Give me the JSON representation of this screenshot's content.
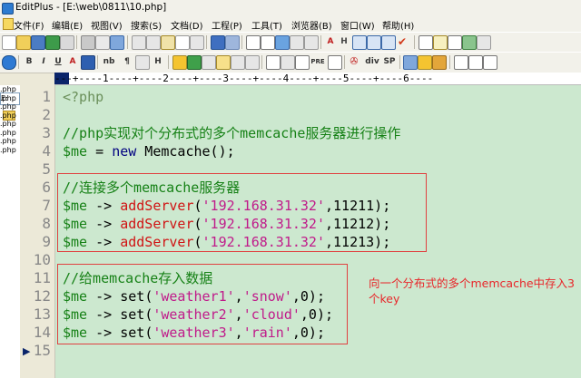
{
  "window": {
    "title": "EditPlus - [E:\\web\\0811\\10.php]"
  },
  "menu": {
    "items": [
      "文件(F)",
      "编辑(E)",
      "视图(V)",
      "搜索(S)",
      "文档(D)",
      "工程(P)",
      "工具(T)",
      "浏览器(B)",
      "窗口(W)",
      "帮助(H)"
    ]
  },
  "toolbar2": {
    "labels": [
      "B",
      "I",
      "U",
      "A",
      "nb",
      "¶",
      "H",
      "PRE",
      "div",
      "SP"
    ]
  },
  "ruler": {
    "text": "---+----1----+----2----+----3----+----4----+----5----+----6----"
  },
  "left_panel": {
    "drive": "E:",
    "files": [
      ".php",
      ".php",
      ".php",
      ".php",
      ".php",
      ".php",
      ".php",
      ".php"
    ]
  },
  "editor": {
    "line_numbers": [
      "1",
      "2",
      "3",
      "4",
      "5",
      "6",
      "7",
      "8",
      "9",
      "10",
      "11",
      "12",
      "13",
      "14",
      "15"
    ],
    "lines": [
      {
        "tokens": [
          {
            "text": "<?php",
            "color": "#6a8f5a"
          }
        ]
      },
      {
        "tokens": []
      },
      {
        "tokens": [
          {
            "text": "//php实现对个分布式的多个memcache服务器进行操作",
            "color": "#168116"
          }
        ]
      },
      {
        "tokens": [
          {
            "text": "$me",
            "color": "#168116"
          },
          {
            "text": " = ",
            "color": "#000000"
          },
          {
            "text": "new",
            "color": "#000080"
          },
          {
            "text": " Memcache();",
            "color": "#000000"
          }
        ]
      },
      {
        "tokens": []
      },
      {
        "tokens": [
          {
            "text": "//连接多个memcache服务器",
            "color": "#168116"
          }
        ]
      },
      {
        "tokens": [
          {
            "text": "$me",
            "color": "#168116"
          },
          {
            "text": " -> ",
            "color": "#000000"
          },
          {
            "text": "addServer",
            "color": "#d01414"
          },
          {
            "text": "(",
            "color": "#000000"
          },
          {
            "text": "'192.168.31.32'",
            "color": "#c01a8a"
          },
          {
            "text": ",11211);",
            "color": "#000000"
          }
        ]
      },
      {
        "tokens": [
          {
            "text": "$me",
            "color": "#168116"
          },
          {
            "text": " -> ",
            "color": "#000000"
          },
          {
            "text": "addServer",
            "color": "#d01414"
          },
          {
            "text": "(",
            "color": "#000000"
          },
          {
            "text": "'192.168.31.32'",
            "color": "#c01a8a"
          },
          {
            "text": ",11212);",
            "color": "#000000"
          }
        ]
      },
      {
        "tokens": [
          {
            "text": "$me",
            "color": "#168116"
          },
          {
            "text": " -> ",
            "color": "#000000"
          },
          {
            "text": "addServer",
            "color": "#d01414"
          },
          {
            "text": "(",
            "color": "#000000"
          },
          {
            "text": "'192.168.31.32'",
            "color": "#c01a8a"
          },
          {
            "text": ",11213);",
            "color": "#000000"
          }
        ]
      },
      {
        "tokens": []
      },
      {
        "tokens": [
          {
            "text": "//给memcache存入数据",
            "color": "#168116"
          }
        ]
      },
      {
        "tokens": [
          {
            "text": "$me",
            "color": "#168116"
          },
          {
            "text": " -> ",
            "color": "#000000"
          },
          {
            "text": "set",
            "color": "#000000"
          },
          {
            "text": "(",
            "color": "#000000"
          },
          {
            "text": "'weather1'",
            "color": "#c01a8a"
          },
          {
            "text": ",",
            "color": "#000000"
          },
          {
            "text": "'snow'",
            "color": "#c01a8a"
          },
          {
            "text": ",0);",
            "color": "#000000"
          }
        ]
      },
      {
        "tokens": [
          {
            "text": "$me",
            "color": "#168116"
          },
          {
            "text": " -> ",
            "color": "#000000"
          },
          {
            "text": "set",
            "color": "#000000"
          },
          {
            "text": "(",
            "color": "#000000"
          },
          {
            "text": "'weather2'",
            "color": "#c01a8a"
          },
          {
            "text": ",",
            "color": "#000000"
          },
          {
            "text": "'cloud'",
            "color": "#c01a8a"
          },
          {
            "text": ",0);",
            "color": "#000000"
          }
        ]
      },
      {
        "tokens": [
          {
            "text": "$me",
            "color": "#168116"
          },
          {
            "text": " -> ",
            "color": "#000000"
          },
          {
            "text": "set",
            "color": "#000000"
          },
          {
            "text": "(",
            "color": "#000000"
          },
          {
            "text": "'weather3'",
            "color": "#c01a8a"
          },
          {
            "text": ",",
            "color": "#000000"
          },
          {
            "text": "'rain'",
            "color": "#c01a8a"
          },
          {
            "text": ",0);",
            "color": "#000000"
          }
        ]
      },
      {
        "tokens": []
      }
    ],
    "annotation": "向一个分布式的多个memcache中存入3个key"
  }
}
